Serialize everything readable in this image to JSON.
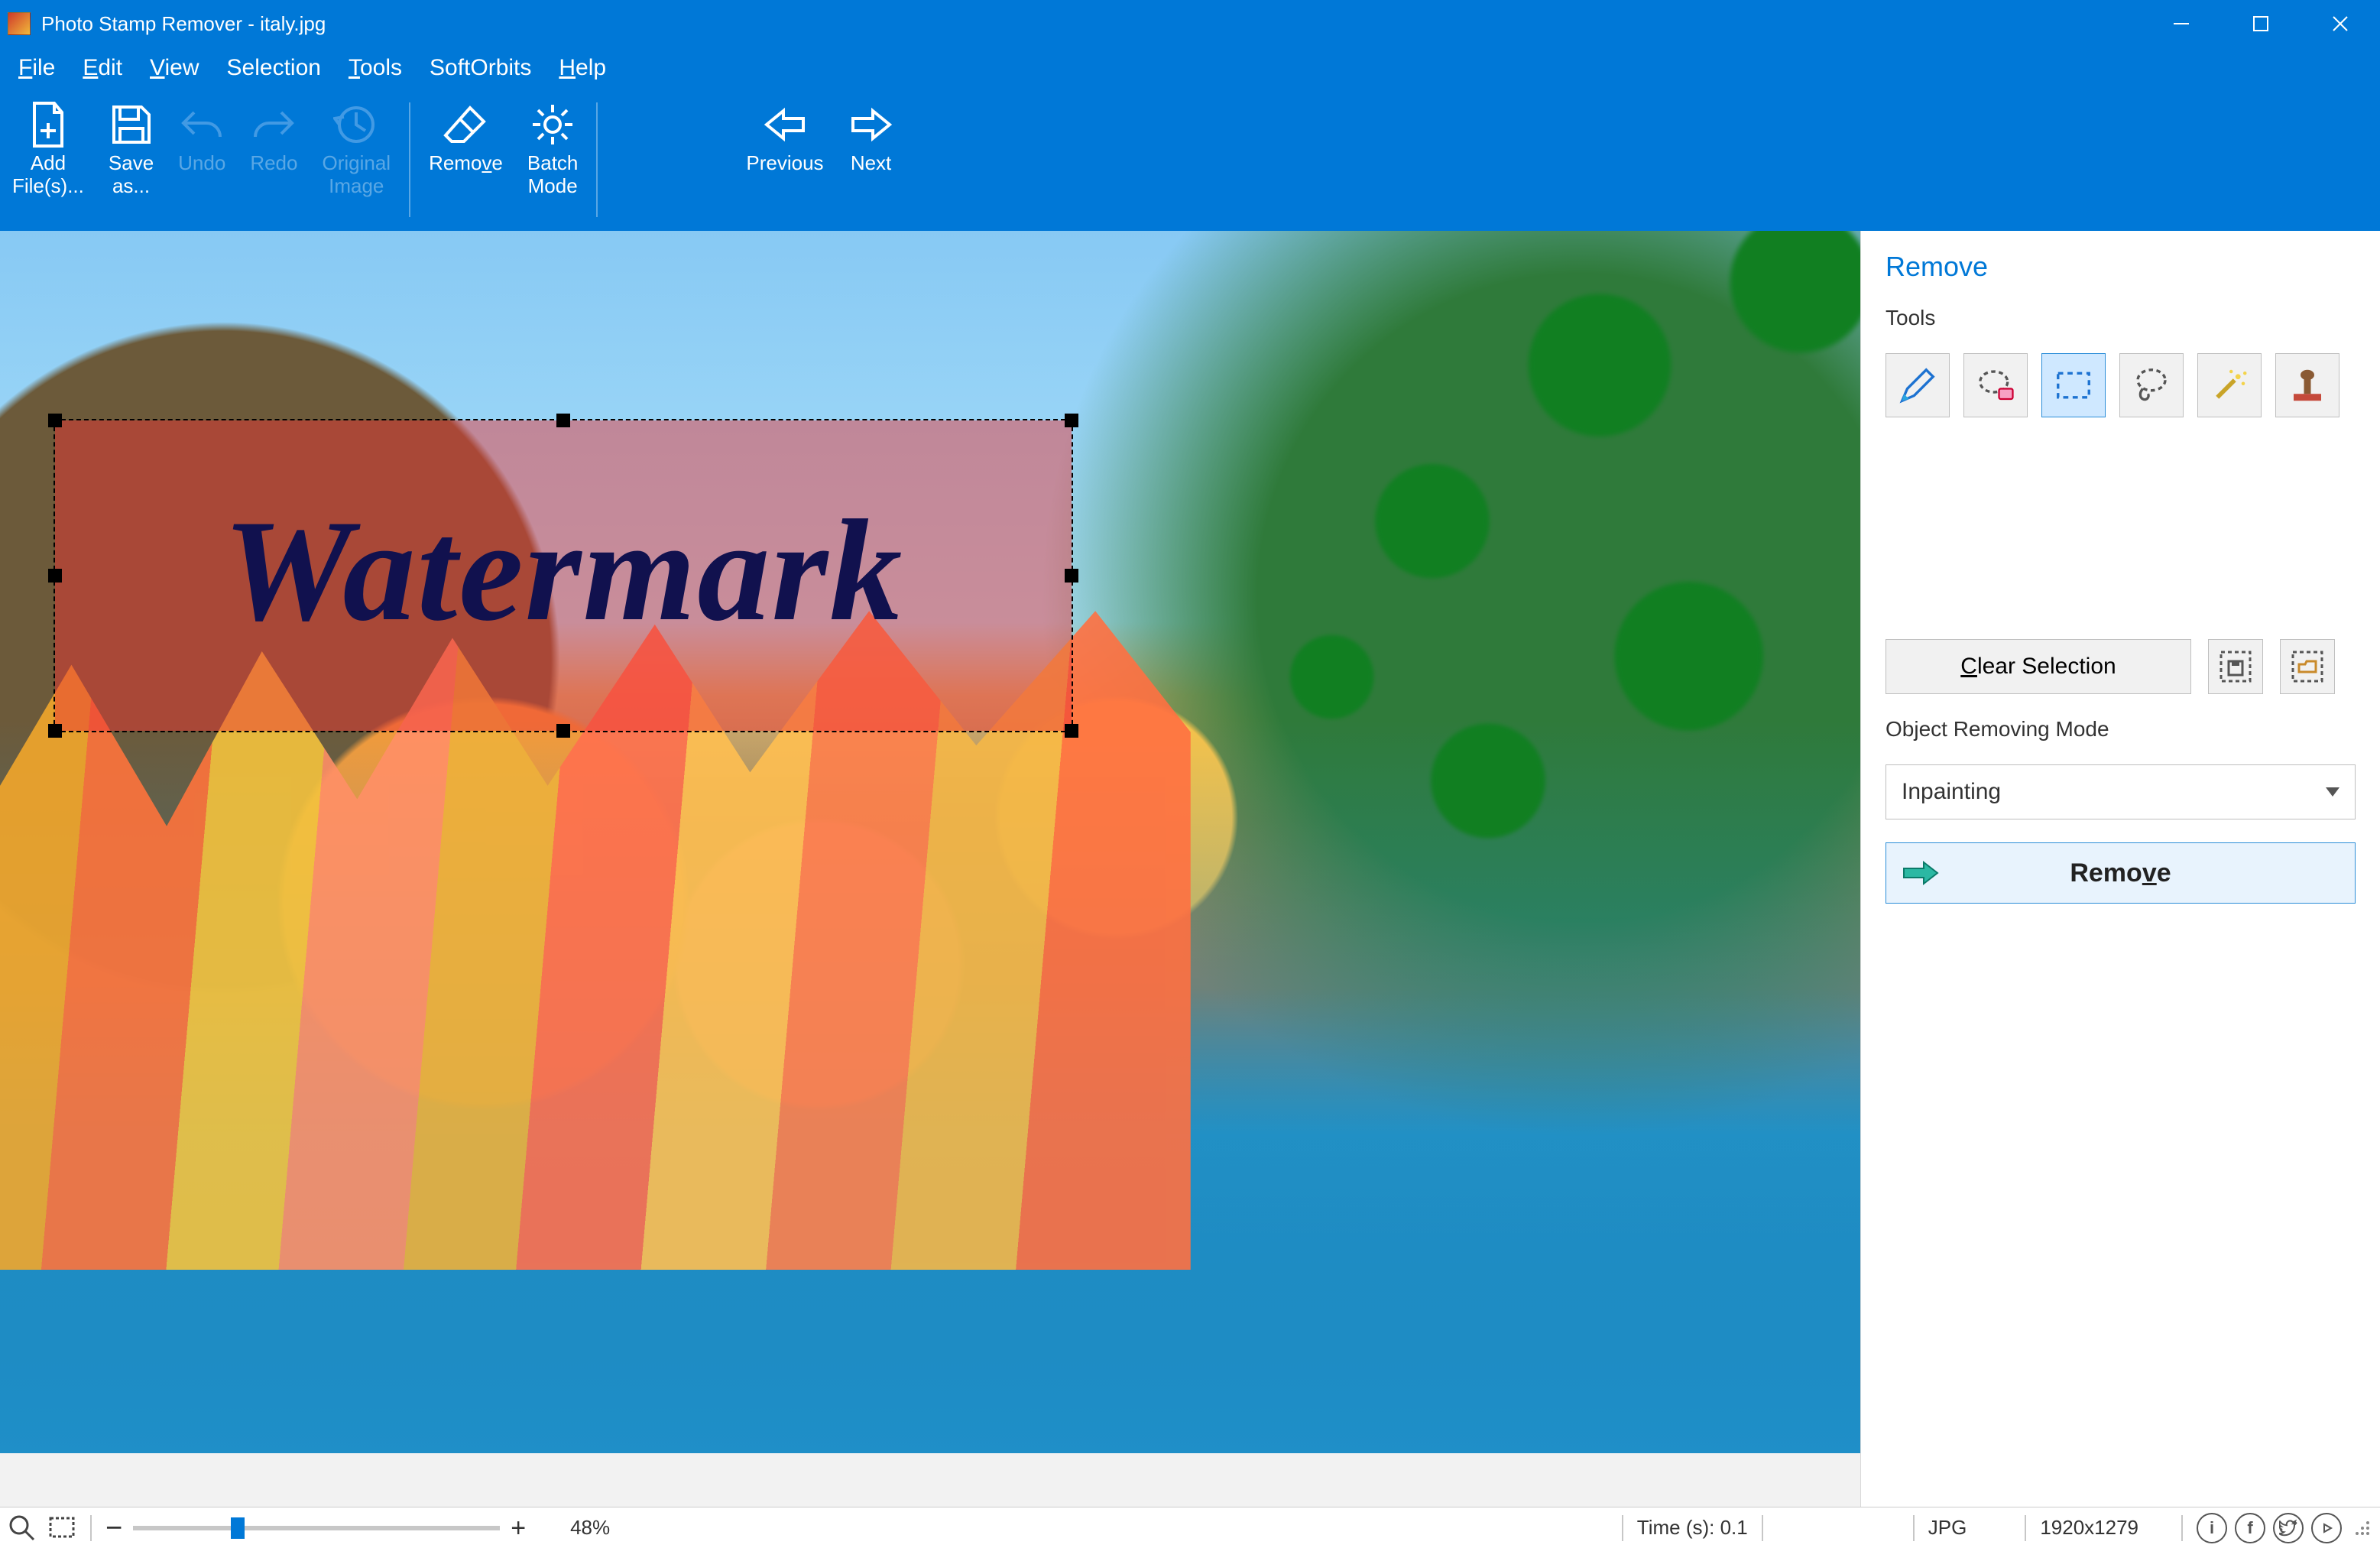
{
  "window": {
    "title": "Photo Stamp Remover - italy.jpg"
  },
  "menu": {
    "file": "File",
    "edit": "Edit",
    "view": "View",
    "selection": "Selection",
    "tools": "Tools",
    "softorbits": "SoftOrbits",
    "help": "Help"
  },
  "ribbon": {
    "add_files": "Add\nFile(s)...",
    "save_as": "Save\nas...",
    "undo": "Undo",
    "redo": "Redo",
    "original": "Original\nImage",
    "remove": "Remove",
    "batch": "Batch\nMode",
    "previous": "Previous",
    "next": "Next"
  },
  "panel": {
    "heading": "Remove",
    "tools_label": "Tools",
    "clear_selection": "Clear Selection",
    "mode_label": "Object Removing Mode",
    "mode_value": "Inpainting",
    "remove_btn": "Remove"
  },
  "canvas": {
    "watermark_text": "Watermark"
  },
  "status": {
    "zoom_percent": "48%",
    "time_label": "Time (s): 0.1",
    "format": "JPG",
    "dimensions": "1920x1279"
  }
}
